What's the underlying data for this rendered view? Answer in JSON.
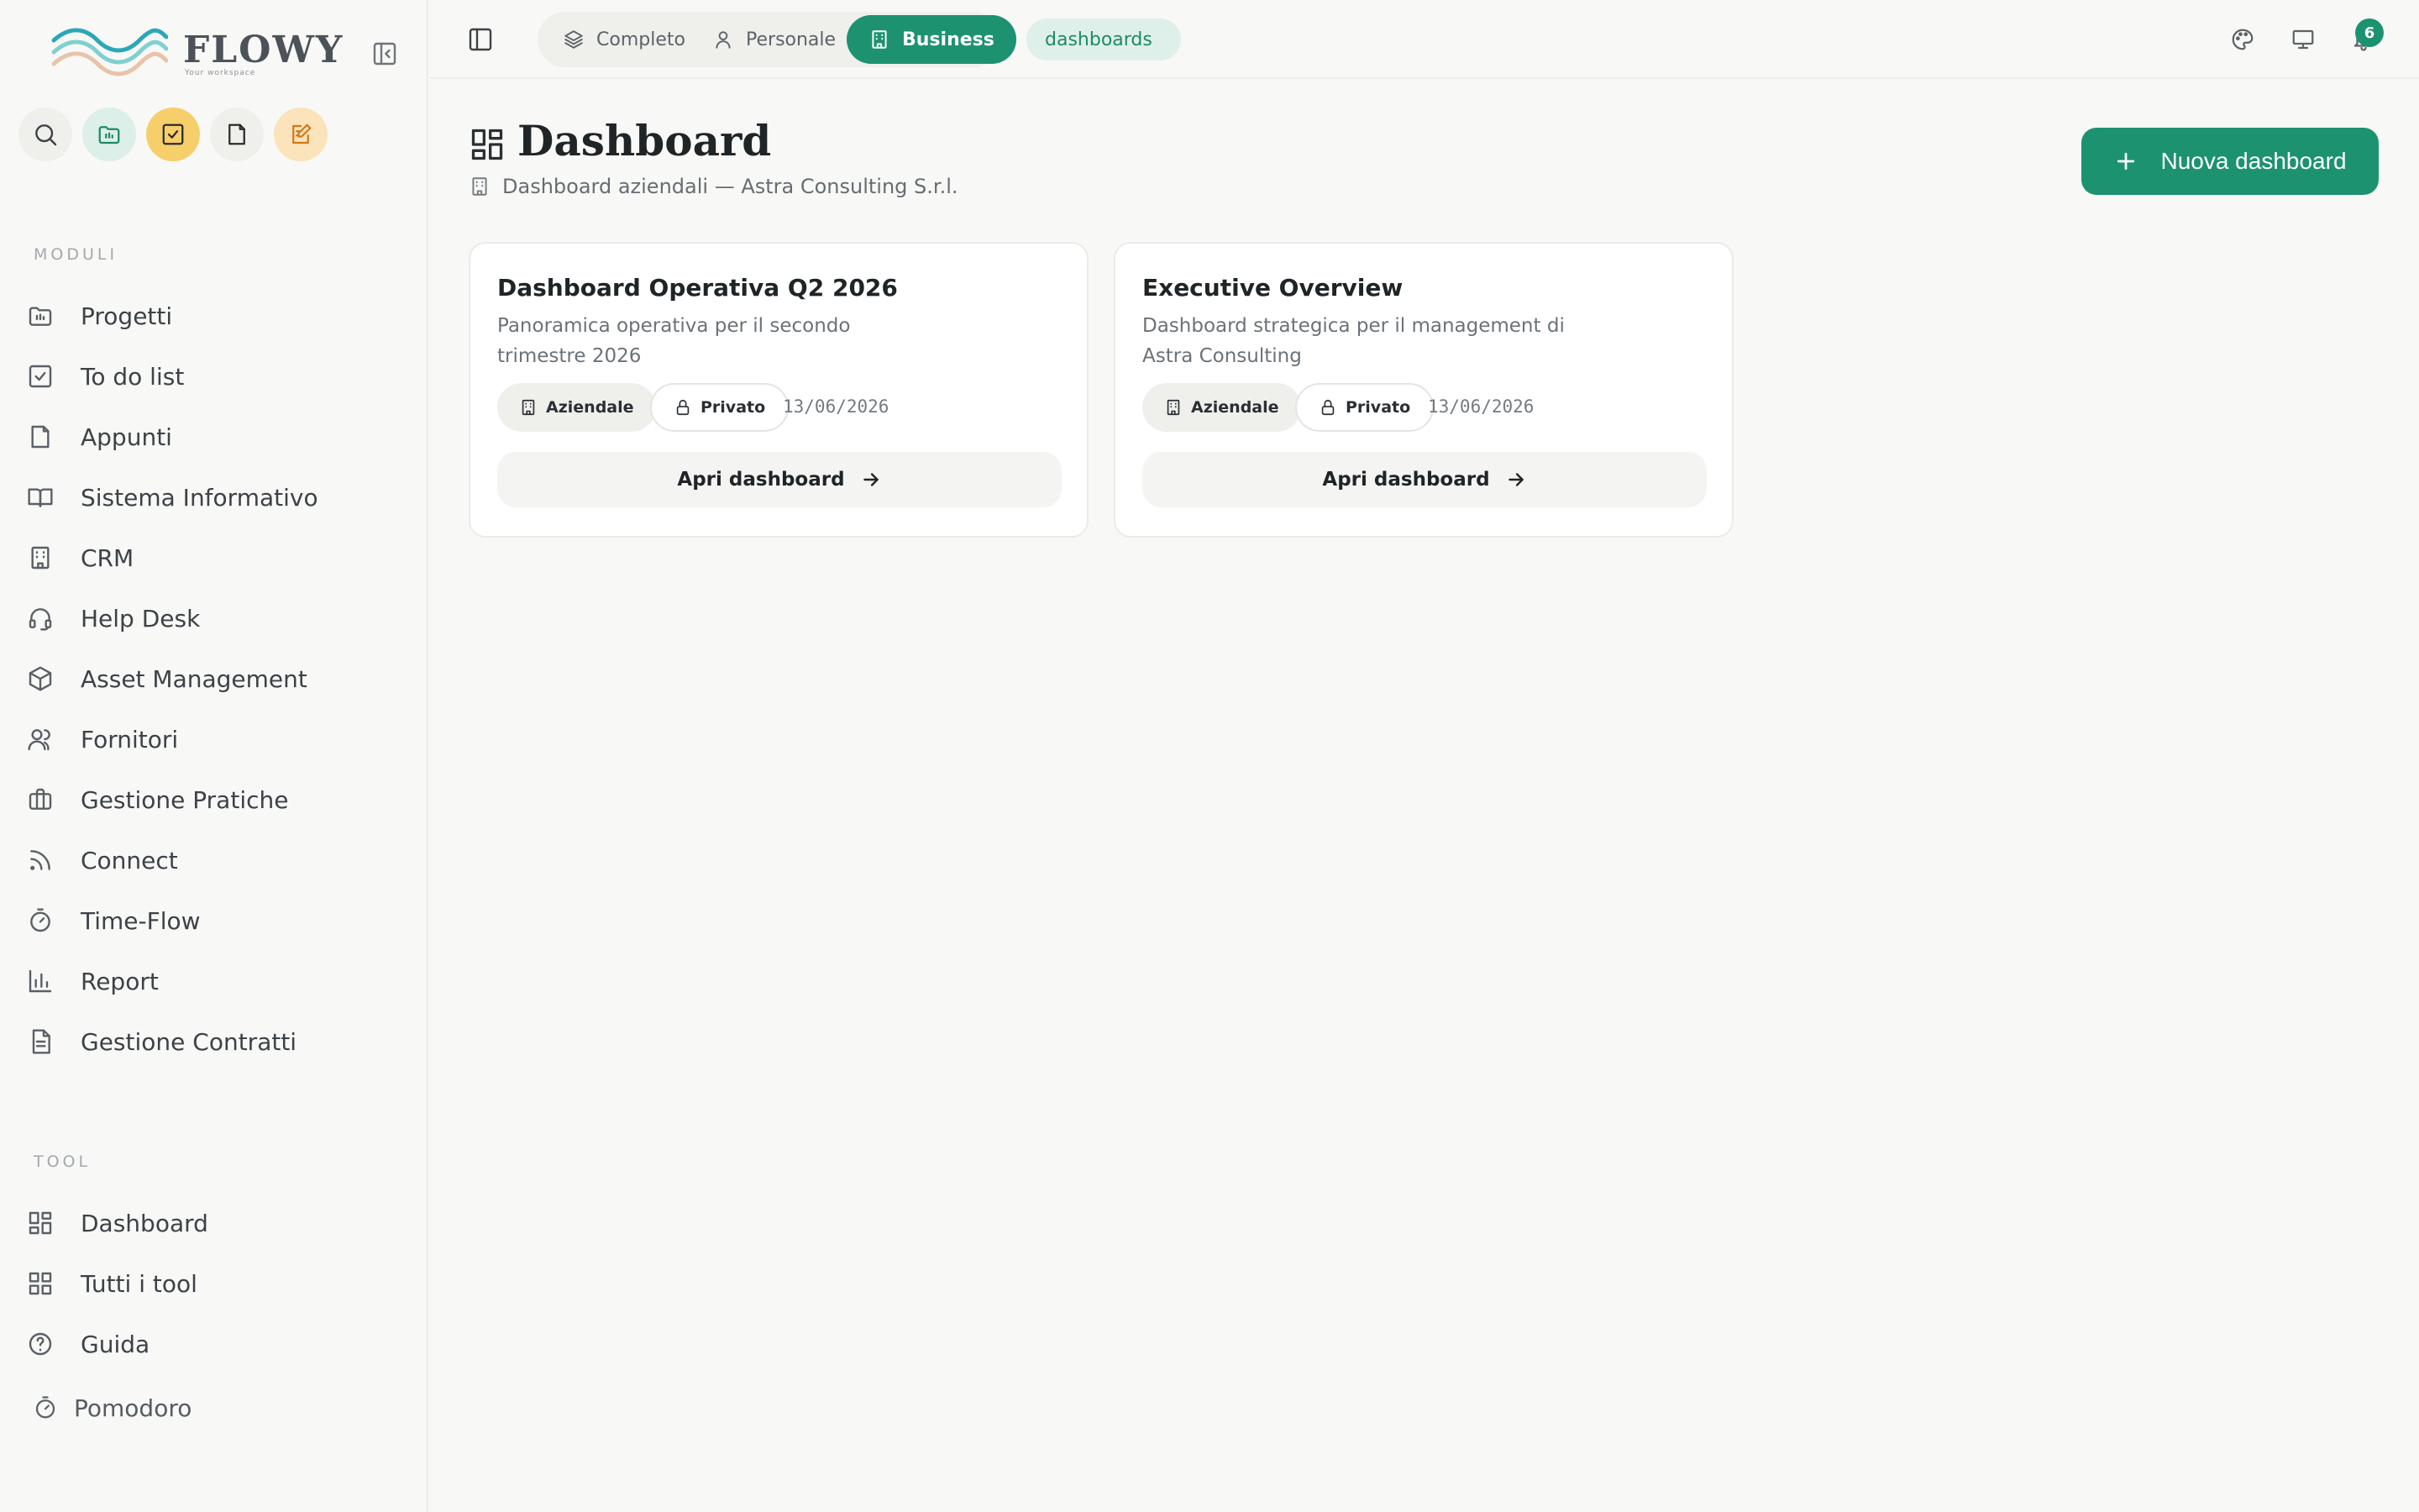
{
  "app": {
    "logo_text": "FLOWY",
    "logo_tagline": "Your workspace"
  },
  "sidebar": {
    "section_modules": "MODULI",
    "section_tools": "TOOL",
    "modules": [
      {
        "label": "Progetti",
        "icon": "folder-chart-icon"
      },
      {
        "label": "To do list",
        "icon": "checkbox-icon"
      },
      {
        "label": "Appunti",
        "icon": "note-icon"
      },
      {
        "label": "Sistema Informativo",
        "icon": "book-icon"
      },
      {
        "label": "CRM",
        "icon": "building-icon"
      },
      {
        "label": "Help Desk",
        "icon": "headset-icon"
      },
      {
        "label": "Asset Management",
        "icon": "box-icon"
      },
      {
        "label": "Fornitori",
        "icon": "users-icon"
      },
      {
        "label": "Gestione Pratiche",
        "icon": "briefcase-icon"
      },
      {
        "label": "Connect",
        "icon": "rss-icon"
      },
      {
        "label": "Time-Flow",
        "icon": "timer-icon"
      },
      {
        "label": "Report",
        "icon": "bar-chart-icon"
      },
      {
        "label": "Gestione Contratti",
        "icon": "document-icon"
      }
    ],
    "tools": [
      {
        "label": "Dashboard",
        "icon": "dashboard-icon"
      },
      {
        "label": "Tutti i tool",
        "icon": "grid-icon"
      },
      {
        "label": "Guida",
        "icon": "help-circle-icon"
      }
    ],
    "pomodoro": "Pomodoro"
  },
  "topbar": {
    "modes": [
      {
        "label": "Completo",
        "icon": "layers-icon",
        "active": false
      },
      {
        "label": "Personale",
        "icon": "user-icon",
        "active": false
      },
      {
        "label": "Business",
        "icon": "building-icon",
        "active": true
      }
    ],
    "route_chip": "dashboards",
    "notifications_count": "6"
  },
  "main": {
    "title": "Dashboard",
    "subtitle": "Dashboard aziendali — Astra Consulting S.r.l.",
    "new_button": "Nuova dashboard",
    "cards": [
      {
        "title": "Dashboard Operativa Q2 2026",
        "description": "Panoramica operativa per il secondo trimestre 2026",
        "scope": "Aziendale",
        "visibility": "Privato",
        "date": "13/06/2026",
        "open_label": "Apri dashboard"
      },
      {
        "title": "Executive Overview",
        "description": "Dashboard strategica per il management di Astra Consulting",
        "scope": "Aziendale",
        "visibility": "Privato",
        "date": "13/06/2026",
        "open_label": "Apri dashboard"
      }
    ]
  },
  "colors": {
    "accent": "#1d9270",
    "accent_soft": "#dff0ea",
    "todo_yellow": "#f6cf6b",
    "edit_orange": "#fbe3bb"
  }
}
